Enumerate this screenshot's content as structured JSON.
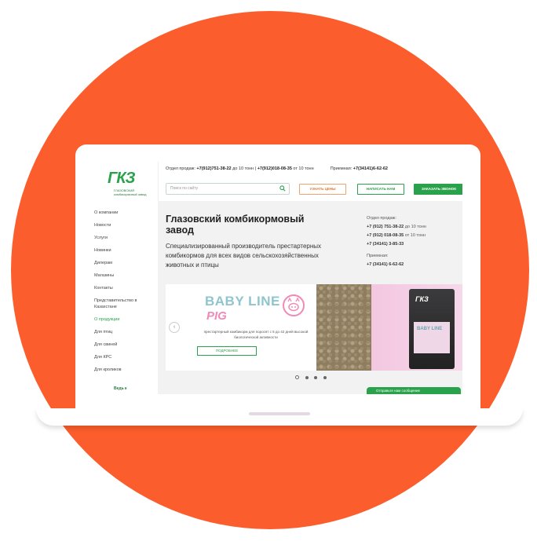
{
  "colors": {
    "background_circle": "#fb5d2c",
    "brand_green": "#2aa24b",
    "accent_orange": "#e07a3a"
  },
  "logo": {
    "mark": "ГКЗ",
    "subtitle": "ГЛАЗОВСКИЙ комбикормовый завод"
  },
  "header": {
    "sales_label": "Отдел продаж:",
    "phone1": "+7(912)751-38-22",
    "phone1_note": "до 10 тонн",
    "phone2": "+7(912)018-08-35",
    "phone2_note": "от 10 тонн",
    "reception_label": "Приемная:",
    "reception_phone": "+7(34141)6-62-62"
  },
  "search": {
    "placeholder": "Поиск по сайту",
    "icon": "search-icon"
  },
  "buttons": {
    "price": "УЗНАТЬ ЦЕНЫ",
    "write": "НАПИСАТЬ НАМ",
    "call": "ЗАКАЗАТЬ ЗВОНОК"
  },
  "sidebar": {
    "items": [
      {
        "label": "О компании"
      },
      {
        "label": "Новости"
      },
      {
        "label": "Услуги"
      },
      {
        "label": "Новинки"
      },
      {
        "label": "Дилерам"
      },
      {
        "label": "Магазины"
      },
      {
        "label": "Контакты"
      },
      {
        "label": "Представительство в Казахстане"
      },
      {
        "label": "О продукции"
      },
      {
        "label": "Для птиц"
      },
      {
        "label": "Для свиней"
      },
      {
        "label": "Для КРС"
      },
      {
        "label": "Для кроликов"
      }
    ],
    "banner": "Ведь к"
  },
  "main": {
    "title": "Глазовский комбикормовый завод",
    "lead": "Специализированный производитель престартерных комбикормов для всех видов сельскохозяйственных животных и птицы"
  },
  "contacts": {
    "sales_label": "Отдел продаж:",
    "phone1": "+7 (912) 751-38-22",
    "phone1_note": "до 10 тонн",
    "phone2": "+7 (912) 018-08-35",
    "phone2_note": "от 10 тонн",
    "phone3": "+7 (34141) 3-85-33",
    "reception_label": "Приемная:",
    "reception_phone": "+7 (34141) 6-62-62"
  },
  "slider": {
    "brand_line1": "BABY LINE",
    "brand_line2": "PIG",
    "description": "престартерный комбикорм для поросят с 5 до 42 дней высокой биологической активности",
    "more_button": "ПОДРОБНЕЕ",
    "bag_logo": "ГКЗ",
    "bag_text": "BABY LINE",
    "prev_arrow": "‹",
    "dots": 4,
    "active_dot": 1
  },
  "chat": {
    "label": "Отправьте нам сообщение"
  }
}
